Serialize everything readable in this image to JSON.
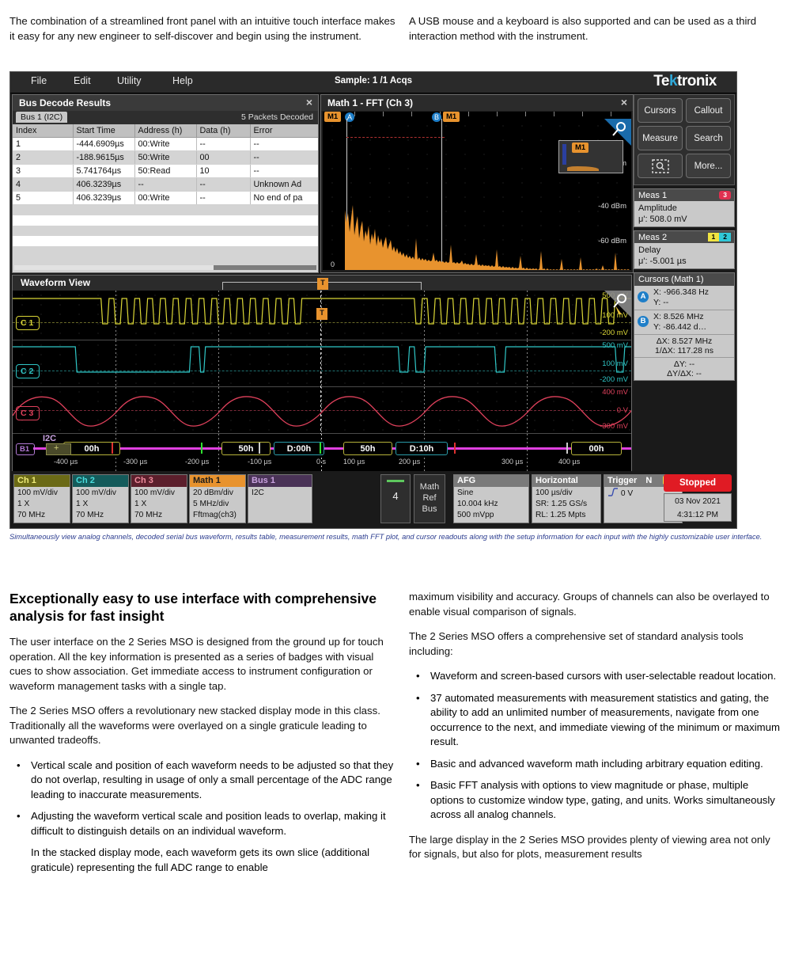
{
  "doc": {
    "left_intro": "The combination of a streamlined front panel with an intuitive touch interface makes it easy for any new engineer to self-discover and begin using the instrument.",
    "right_intro": "A USB mouse and a keyboard is also supported and can be used as a third interaction method with the instrument.",
    "caption": "Simultaneously view analog channels, decoded serial bus waveform, results table, measurement results, math FFT plot, and cursor readouts along with the setup information for each input with the highly customizable user interface.",
    "heading": "Exceptionally easy to use interface with comprehensive analysis for fast insight",
    "left_p1": "The user interface on the 2 Series MSO is designed from the ground up for touch operation. All the key information is presented as a series of badges with visual cues to show association. Get immediate access to instrument configuration or waveform management tasks with a single tap.",
    "left_p2": "The 2 Series MSO offers a revolutionary new stacked display mode in this class. Traditionally all the waveforms were overlayed on a single graticule leading to unwanted tradeoffs.",
    "left_bullets": [
      "Vertical scale and position of each waveform needs to be adjusted so that they do not overlap, resulting in usage of only a small percentage of the ADC range leading to inaccurate measurements.",
      "Adjusting the waveform vertical scale and position leads to overlap, making it difficult to distinguish details on an individual waveform."
    ],
    "left_p3": "In the stacked display mode, each waveform gets its own slice (additional graticule) representing the full ADC range to enable",
    "right_p1": "maximum visibility and accuracy. Groups of channels can also be overlayed to enable visual comparison of signals.",
    "right_p2": "The 2 Series MSO offers a comprehensive set of standard analysis tools including:",
    "right_bullets": [
      "Waveform and screen-based cursors with user-selectable readout location.",
      "37 automated measurements with measurement statistics and gating, the ability to add an unlimited number of measurements, navigate from one occurrence to the next, and immediate viewing of the minimum or maximum result.",
      "Basic and advanced waveform math including arbitrary equation editing.",
      "Basic FFT analysis with options to view magnitude or phase, multiple options to customize window type, gating, and units. Works simultaneously across all analog channels."
    ],
    "right_p3": "The large display in the 2 Series MSO provides plenty of viewing area not only for signals, but also for plots, measurement results",
    "bullet_char": "•"
  },
  "scope": {
    "menu": [
      "File",
      "Edit",
      "Utility",
      "Help"
    ],
    "sample_status": "Sample: 1 /1 Acqs",
    "brand_pre": "Te",
    "brand_k": "k",
    "brand_post": "tronix",
    "results": {
      "title": "Bus Decode Results",
      "close_icon": "×",
      "tab": "Bus 1 (I2C)",
      "packets": "5 Packets Decoded",
      "columns": [
        "Index",
        "Start Time",
        "Address (h)",
        "Data (h)",
        "Error"
      ],
      "rows": [
        [
          "1",
          "-444.6909µs",
          "00:Write",
          "--",
          "--"
        ],
        [
          "2",
          "-188.9615µs",
          "50:Write",
          "00",
          "--"
        ],
        [
          "3",
          "5.741764µs",
          "50:Read",
          "10",
          "--"
        ],
        [
          "4",
          "406.3239µs",
          "--",
          "--",
          "Unknown Ad"
        ],
        [
          "5",
          "406.3239µs",
          "00:Write",
          "--",
          "No end of pa"
        ]
      ]
    },
    "fft": {
      "title": "Math 1 - FFT (Ch 3)",
      "close_icon": "×",
      "badges": [
        "M1",
        "A",
        "B",
        "M1",
        "M1"
      ],
      "y_labels": [
        "-20 dBm",
        "-40 dBm",
        "-60 dBm"
      ],
      "origin_label": "0"
    },
    "buttons": [
      [
        "Cursors",
        "Callout"
      ],
      [
        "Measure",
        "Search"
      ],
      [
        "zoom-select-icon",
        "More..."
      ]
    ],
    "more_label": "More...",
    "meas": [
      {
        "title": "Meas 1",
        "badge": "3",
        "name": "Amplitude",
        "value": "μ': 508.0 mV"
      },
      {
        "title": "Meas 2",
        "badge_a": "1",
        "badge_b": "2",
        "name": "Delay",
        "value": "μ': -5.001 µs"
      }
    ],
    "cursors": {
      "title": "Cursors (Math 1)",
      "a_label": "A",
      "a_x": "X: -966.348 Hz",
      "a_y": "Y: --",
      "b_label": "B",
      "b_x": "X: 8.526 MHz",
      "b_y": "Y: -86.442 d…",
      "dx": "ΔX: 8.527 MHz",
      "inv_dx": "1/ΔX: 117.28 ns",
      "dy": "ΔY: --",
      "dydx": "ΔY/ΔX: --"
    },
    "waveform": {
      "title": "Waveform View",
      "channels": [
        {
          "tag": "C 1",
          "color": "#d9d536",
          "labels": [
            "500 mV",
            "100 mV",
            "-200 mV"
          ]
        },
        {
          "tag": "C 2",
          "color": "#2fc5c5",
          "labels": [
            "500 mV",
            "100 mV",
            "-200 mV"
          ]
        },
        {
          "tag": "C 3",
          "color": "#e0415c",
          "labels": [
            "400 mV",
            "0 V",
            "-300 mV"
          ]
        }
      ],
      "bus_tag": "B1",
      "bus_name": "I2C",
      "packets": [
        "00h",
        "50h",
        "D:00h",
        "50h",
        "D:10h",
        "00h"
      ],
      "time_labels": [
        "-400 µs",
        "-300 µs",
        "-200 µs",
        "-100 µs",
        "0 s",
        "100 µs",
        "200 µs",
        "300 µs",
        "400 µs"
      ],
      "trigger_marker": "T"
    },
    "badges": {
      "channels": [
        {
          "name": "Ch 1",
          "color": "#6b6a16",
          "text": "#f0ee7a",
          "lines": [
            "100 mV/div",
            "1 X",
            "70 MHz"
          ]
        },
        {
          "name": "Ch 2",
          "color": "#145b5b",
          "text": "#49dede",
          "lines": [
            "100 mV/div",
            "1 X",
            "70 MHz"
          ]
        },
        {
          "name": "Ch 3",
          "color": "#5c1f2c",
          "text": "#f08d9e",
          "lines": [
            "100 mV/div",
            "1 X",
            "70 MHz"
          ]
        },
        {
          "name": "Math 1",
          "color": "#e8932e",
          "text": "#1a1a1a",
          "lines": [
            "20 dBm/div",
            "5 MHz/div",
            "Fftmag(ch3)"
          ]
        },
        {
          "name": "Bus 1",
          "color": "#4a3357",
          "text": "#c9a2e0",
          "lines": [
            "I2C",
            "",
            ""
          ]
        }
      ],
      "chan_count": "4",
      "math_ref_bus": [
        "Math",
        "Ref",
        "Bus"
      ],
      "afg": {
        "title": "AFG",
        "lines": [
          "Sine",
          "10.004 kHz",
          "500 mVpp"
        ]
      },
      "horizontal": {
        "title": "Horizontal",
        "lines": [
          "100 µs/div",
          "SR: 1.25 GS/s",
          "RL: 1.25 Mpts"
        ]
      },
      "trigger": {
        "title": "Trigger",
        "mode": "N",
        "pill": "1",
        "value": "0 V",
        "edge_icon": "rising-edge-icon"
      },
      "run_state": "Stopped",
      "date": "03 Nov 2021",
      "time": "4:31:12 PM"
    }
  }
}
